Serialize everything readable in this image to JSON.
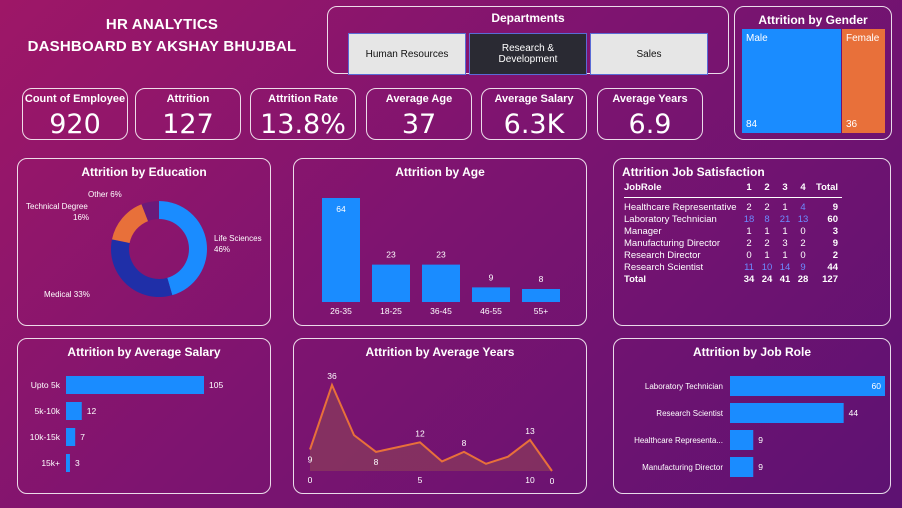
{
  "header": {
    "line1": "HR ANALYTICS",
    "line2": "DASHBOARD BY AKSHAY BHUJBAL"
  },
  "departments": {
    "title": "Departments",
    "options": [
      "Human Resources",
      "Research &\nDevelopment",
      "Sales"
    ],
    "selected": "Research & Development"
  },
  "gender": {
    "title": "Attrition by Gender",
    "male_label": "Male",
    "male_value": "84",
    "female_label": "Female",
    "female_value": "36",
    "colors": {
      "male": "#1a8cff",
      "female": "#e8703a"
    }
  },
  "kpis": [
    {
      "label": "Count of Employee",
      "value": "920"
    },
    {
      "label": "Attrition",
      "value": "127"
    },
    {
      "label": "Attrition Rate",
      "value": "13.8%"
    },
    {
      "label": "Average Age",
      "value": "37"
    },
    {
      "label": "Average Salary",
      "value": "6.3K"
    },
    {
      "label": "Average Years",
      "value": "6.9"
    }
  ],
  "education": {
    "title": "Attrition by Education",
    "labels": [
      "Other 6%",
      "Technical Degree",
      "16%",
      "Life Sciences",
      "46%",
      "Medical 33%"
    ]
  },
  "age": {
    "title": "Attrition by Age"
  },
  "job_satisfaction": {
    "title": "Attrition Job Satisfaction",
    "headers": [
      "JobRole",
      "1",
      "2",
      "3",
      "4",
      "Total"
    ],
    "rows": [
      [
        "Healthcare Representative",
        "2",
        "2",
        "1",
        "4",
        "9"
      ],
      [
        "Laboratory Technician",
        "18",
        "8",
        "21",
        "13",
        "60"
      ],
      [
        "Manager",
        "1",
        "1",
        "1",
        "0",
        "3"
      ],
      [
        "Manufacturing Director",
        "2",
        "2",
        "3",
        "2",
        "9"
      ],
      [
        "Research Director",
        "0",
        "1",
        "1",
        "0",
        "2"
      ],
      [
        "Research Scientist",
        "11",
        "10",
        "14",
        "9",
        "44"
      ]
    ],
    "total": [
      "Total",
      "34",
      "24",
      "41",
      "28",
      "127"
    ]
  },
  "salary": {
    "title": "Attrition by Average Salary"
  },
  "years": {
    "title": "Attrition by Average Years"
  },
  "jobrole": {
    "title": "Attrition by Job Role"
  },
  "chart_data": [
    {
      "type": "pie",
      "title": "Attrition by Education",
      "categories": [
        "Life Sciences",
        "Medical",
        "Technical Degree",
        "Other"
      ],
      "values": [
        46,
        33,
        16,
        6
      ],
      "colors": [
        "#1a8cff",
        "#1f2fa8",
        "#e8703a",
        "#6b1a7a"
      ]
    },
    {
      "type": "bar",
      "title": "Attrition by Age",
      "categories": [
        "26-35",
        "18-25",
        "36-45",
        "46-55",
        "55+"
      ],
      "values": [
        64,
        23,
        23,
        9,
        8
      ]
    },
    {
      "type": "bar",
      "title": "Attrition by Average Salary",
      "categories": [
        "Upto 5k",
        "5k-10k",
        "10k-15k",
        "15k+"
      ],
      "values": [
        105,
        12,
        7,
        3
      ]
    },
    {
      "type": "area",
      "title": "Attrition by Average Years",
      "x": [
        0,
        1,
        2,
        3,
        4,
        5,
        6,
        7,
        8,
        9,
        10,
        11
      ],
      "values": [
        9,
        36,
        15,
        8,
        10,
        12,
        4,
        8,
        3,
        6,
        13,
        0
      ],
      "data_labels": {
        "0": "9",
        "1": "36",
        "3": "8",
        "5": "12",
        "7": "8",
        "10": "13",
        "11": "0"
      },
      "x_ticks": [
        0,
        5,
        10
      ]
    },
    {
      "type": "bar",
      "title": "Attrition by Job Role",
      "categories": [
        "Laboratory Technician",
        "Research Scientist",
        "Healthcare Representa...",
        "Manufacturing Director"
      ],
      "values": [
        60,
        44,
        9,
        9
      ]
    }
  ]
}
